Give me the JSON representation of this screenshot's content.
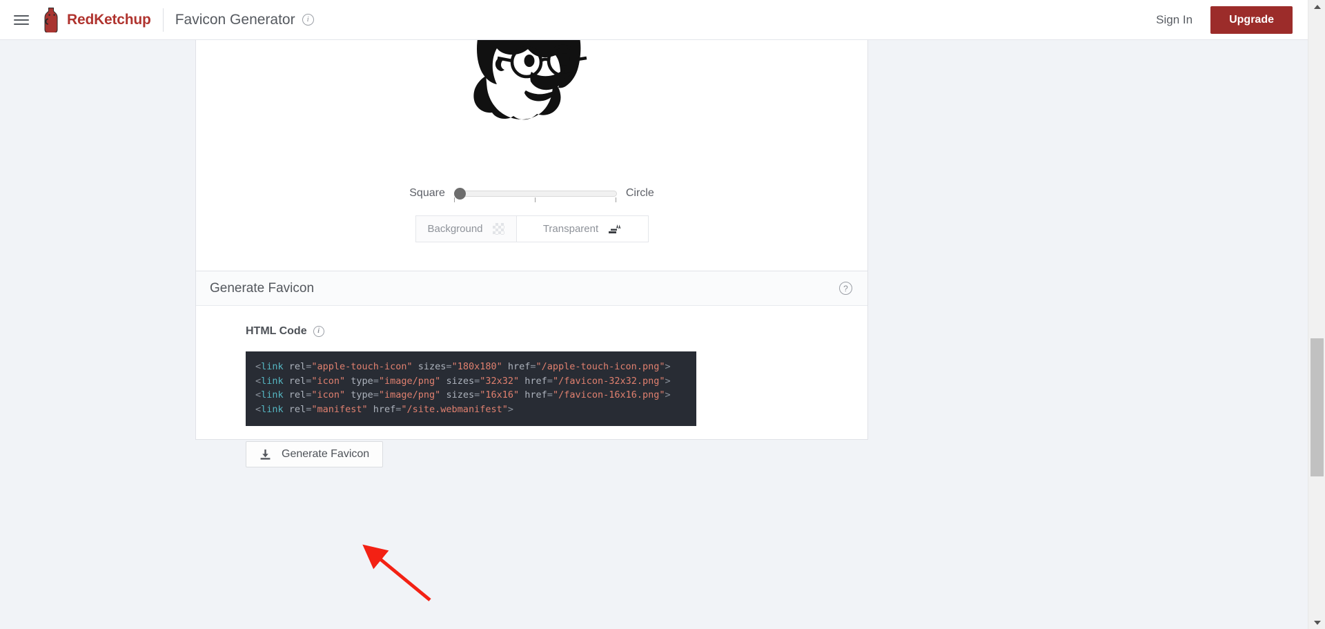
{
  "header": {
    "menu_icon": "hamburger-menu-icon",
    "brand": "RedKetchup",
    "logo_icon": "ketchup-bottle-icon",
    "page_title": "Favicon Generator",
    "title_info_icon": "info-icon",
    "sign_in": "Sign In",
    "upgrade": "Upgrade",
    "brand_color": "#b0342f",
    "upgrade_bg": "#9c2c2a"
  },
  "preview_card": {
    "image_alt": "bearded-man-with-glasses-illustration",
    "shape_slider": {
      "left_label": "Square",
      "right_label": "Circle",
      "value": 0,
      "min": 0,
      "max": 100
    },
    "background_toggle": {
      "options": [
        {
          "label": "Background",
          "icon": "checkerboard-icon",
          "selected": false
        },
        {
          "label": "Transparent",
          "icon": "ink-stamp-icon",
          "selected": true
        }
      ]
    }
  },
  "generate_card": {
    "title": "Generate Favicon",
    "help_icon": "help-circle-icon",
    "html_code_label": "HTML Code",
    "html_code_info_icon": "info-icon",
    "code_lines": [
      [
        {
          "t": "<",
          "c": "p"
        },
        {
          "t": "link",
          "c": "t"
        },
        {
          "t": " ",
          "c": "p"
        },
        {
          "t": "rel",
          "c": "a"
        },
        {
          "t": "=",
          "c": "p"
        },
        {
          "t": "\"apple-touch-icon\"",
          "c": "s"
        },
        {
          "t": " ",
          "c": "p"
        },
        {
          "t": "sizes",
          "c": "a"
        },
        {
          "t": "=",
          "c": "p"
        },
        {
          "t": "\"180x180\"",
          "c": "s"
        },
        {
          "t": " ",
          "c": "p"
        },
        {
          "t": "href",
          "c": "a"
        },
        {
          "t": "=",
          "c": "p"
        },
        {
          "t": "\"/apple-touch-icon.png\"",
          "c": "s"
        },
        {
          "t": ">",
          "c": "p"
        }
      ],
      [
        {
          "t": "<",
          "c": "p"
        },
        {
          "t": "link",
          "c": "t"
        },
        {
          "t": " ",
          "c": "p"
        },
        {
          "t": "rel",
          "c": "a"
        },
        {
          "t": "=",
          "c": "p"
        },
        {
          "t": "\"icon\"",
          "c": "s"
        },
        {
          "t": " ",
          "c": "p"
        },
        {
          "t": "type",
          "c": "a"
        },
        {
          "t": "=",
          "c": "p"
        },
        {
          "t": "\"image/png\"",
          "c": "s"
        },
        {
          "t": " ",
          "c": "p"
        },
        {
          "t": "sizes",
          "c": "a"
        },
        {
          "t": "=",
          "c": "p"
        },
        {
          "t": "\"32x32\"",
          "c": "s"
        },
        {
          "t": " ",
          "c": "p"
        },
        {
          "t": "href",
          "c": "a"
        },
        {
          "t": "=",
          "c": "p"
        },
        {
          "t": "\"/favicon-32x32.png\"",
          "c": "s"
        },
        {
          "t": ">",
          "c": "p"
        }
      ],
      [
        {
          "t": "<",
          "c": "p"
        },
        {
          "t": "link",
          "c": "t"
        },
        {
          "t": " ",
          "c": "p"
        },
        {
          "t": "rel",
          "c": "a"
        },
        {
          "t": "=",
          "c": "p"
        },
        {
          "t": "\"icon\"",
          "c": "s"
        },
        {
          "t": " ",
          "c": "p"
        },
        {
          "t": "type",
          "c": "a"
        },
        {
          "t": "=",
          "c": "p"
        },
        {
          "t": "\"image/png\"",
          "c": "s"
        },
        {
          "t": " ",
          "c": "p"
        },
        {
          "t": "sizes",
          "c": "a"
        },
        {
          "t": "=",
          "c": "p"
        },
        {
          "t": "\"16x16\"",
          "c": "s"
        },
        {
          "t": " ",
          "c": "p"
        },
        {
          "t": "href",
          "c": "a"
        },
        {
          "t": "=",
          "c": "p"
        },
        {
          "t": "\"/favicon-16x16.png\"",
          "c": "s"
        },
        {
          "t": ">",
          "c": "p"
        }
      ],
      [
        {
          "t": "<",
          "c": "p"
        },
        {
          "t": "link",
          "c": "t"
        },
        {
          "t": " ",
          "c": "p"
        },
        {
          "t": "rel",
          "c": "a"
        },
        {
          "t": "=",
          "c": "p"
        },
        {
          "t": "\"manifest\"",
          "c": "s"
        },
        {
          "t": " ",
          "c": "p"
        },
        {
          "t": "href",
          "c": "a"
        },
        {
          "t": "=",
          "c": "p"
        },
        {
          "t": "\"/site.webmanifest\"",
          "c": "s"
        },
        {
          "t": ">",
          "c": "p"
        }
      ]
    ],
    "code_theme": {
      "bg": "#282c34",
      "punctuation": "#8a919b",
      "tag": "#56b6c2",
      "attribute": "#adb3bd",
      "string": "#e0806f"
    },
    "generate_button": {
      "label": "Generate Favicon",
      "icon": "download-icon"
    }
  },
  "annotation": {
    "arrow_color": "#f32114",
    "points_to": "generate-favicon-button"
  },
  "scrollbar": {
    "up_icon": "chevron-up-icon",
    "down_icon": "chevron-down-icon"
  }
}
